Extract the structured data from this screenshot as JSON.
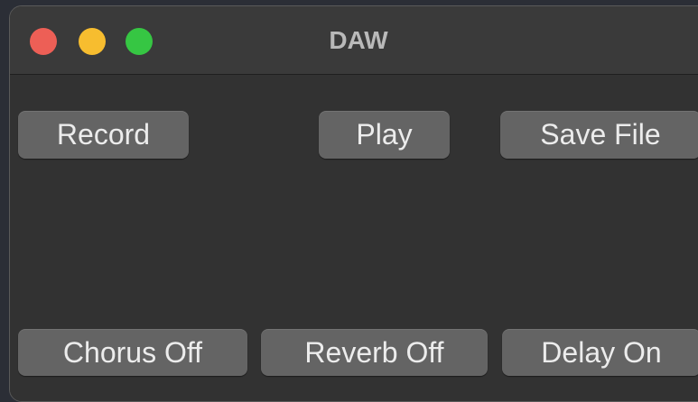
{
  "window": {
    "title": "DAW",
    "controls": {
      "close_color": "#ed5f56",
      "minimize_color": "#f7bd2f",
      "zoom_color": "#36c643"
    }
  },
  "toolbar": {
    "record_label": "Record",
    "play_label": "Play",
    "save_label": "Save File"
  },
  "effects": {
    "chorus_label": "Chorus Off",
    "reverb_label": "Reverb Off",
    "delay_label": "Delay On"
  }
}
